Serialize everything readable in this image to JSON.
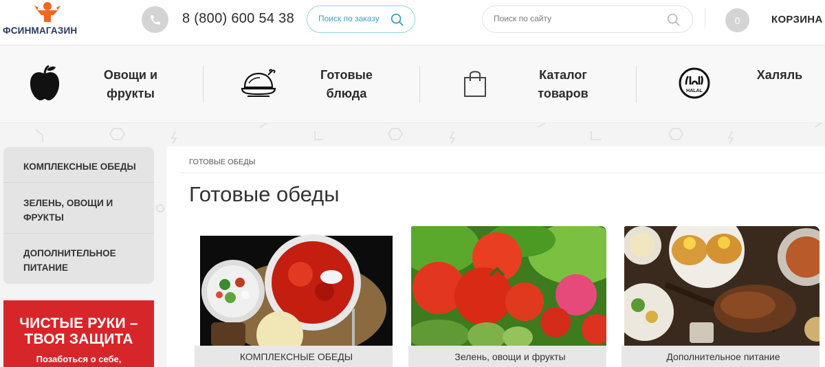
{
  "header": {
    "logo_text": "ФСИНМАГАЗИН",
    "phone": "8 (800) 600 54 38",
    "order_search_placeholder": "Поиск по заказу",
    "site_search_placeholder": "Поиск по сайту",
    "cart_count": "0",
    "cart_label": "КОРЗИНА"
  },
  "categories": [
    {
      "line1": "Овощи и",
      "line2": "фрукты",
      "icon": "apple-icon"
    },
    {
      "line1": "Готовые",
      "line2": "блюда",
      "icon": "roast-chicken-icon"
    },
    {
      "line1": "Каталог",
      "line2": "товаров",
      "icon": "shopping-bag-icon"
    },
    {
      "line1": "Халяль",
      "line2": "",
      "icon": "halal-icon"
    }
  ],
  "sidebar": {
    "items": [
      {
        "label": "Комплексные обеды"
      },
      {
        "label": "Зелень, овощи и фрукты"
      },
      {
        "label": "Дополнительное питание"
      }
    ]
  },
  "promo": {
    "title_line1": "ЧИСТЫЕ РУКИ –",
    "title_line2": "ТВОЯ ЗАЩИТА",
    "subtitle": "Позаботься о себе,"
  },
  "main": {
    "breadcrumb": "ГОТОВЫЕ ОБЕДЫ",
    "title": "Готовые обеды",
    "cards": [
      {
        "caption": "КОМПЛЕКСНЫЕ ОБЕДЫ"
      },
      {
        "caption": "Зелень, овощи и фрукты"
      },
      {
        "caption": "Дополнительное питание"
      }
    ]
  },
  "colors": {
    "brand_orange": "#f26522",
    "brand_navy": "#29375e",
    "accent_blue": "#3d9ec3",
    "promo_red": "#d7262a"
  }
}
